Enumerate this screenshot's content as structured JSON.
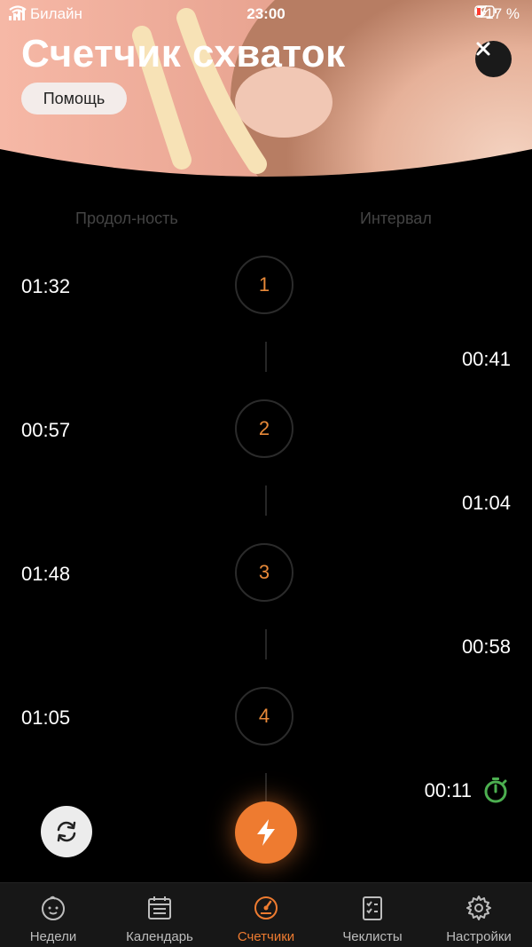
{
  "status_bar": {
    "carrier": "Билайн",
    "time": "23:00",
    "battery": "17 %"
  },
  "header": {
    "title": "Счетчик схваток",
    "help_label": "Помощь"
  },
  "columns": {
    "duration": "Продол-ность",
    "interval": "Интервал"
  },
  "contractions": [
    {
      "number": "1",
      "duration": "01:32",
      "interval": "00:41"
    },
    {
      "number": "2",
      "duration": "00:57",
      "interval": "01:04"
    },
    {
      "number": "3",
      "duration": "01:48",
      "interval": "00:58"
    },
    {
      "number": "4",
      "duration": "01:05",
      "interval": "00:11"
    }
  ],
  "tabs": [
    {
      "label": "Недели",
      "icon": "baby-face-icon"
    },
    {
      "label": "Календарь",
      "icon": "calendar-icon"
    },
    {
      "label": "Счетчики",
      "icon": "gauge-icon"
    },
    {
      "label": "Чеклисты",
      "icon": "checklist-icon"
    },
    {
      "label": "Настройки",
      "icon": "gear-icon"
    }
  ],
  "active_tab": "Счетчики",
  "colors": {
    "accent": "#ee7b30",
    "number": "#e88939",
    "timer_green": "#4caf50"
  }
}
